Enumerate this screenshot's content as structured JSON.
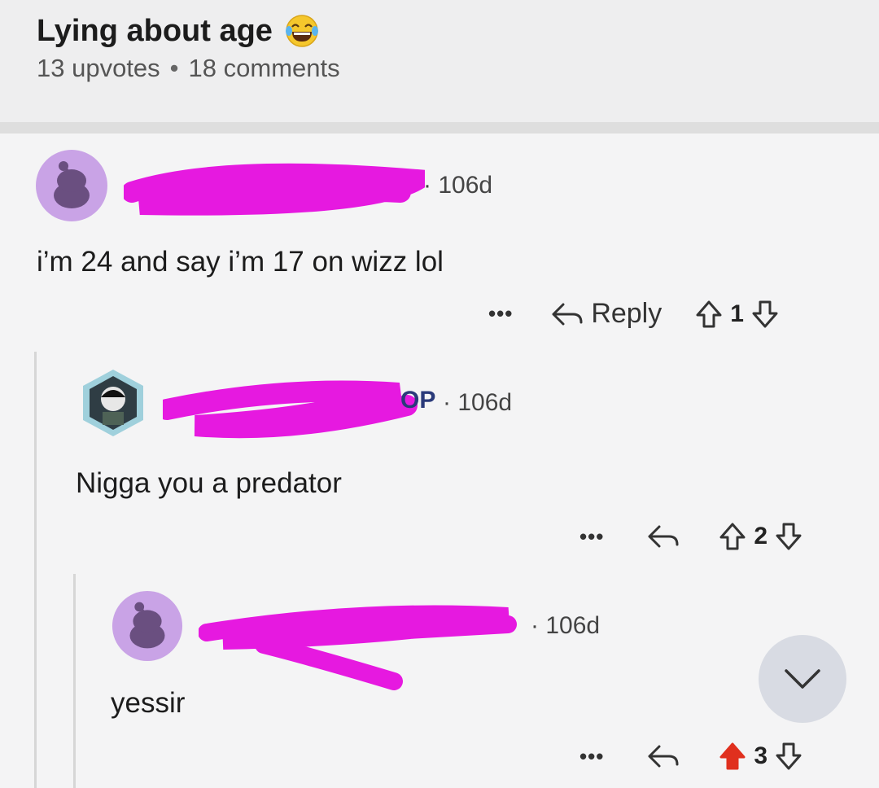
{
  "post": {
    "title": "Lying about age",
    "upvotes": "13 upvotes",
    "comments": "18 comments",
    "separator": "•"
  },
  "comments": [
    {
      "age": "· 106d",
      "text": "i’m 24 and say i’m 17 on wizz lol",
      "actions": {
        "more": "•••",
        "reply": "Reply",
        "score": "1"
      }
    },
    {
      "age": "· 106d",
      "op_visible": "OP",
      "text": "Nigga you a predator",
      "actions": {
        "more": "•••",
        "score": "2"
      }
    },
    {
      "age": "· 106d",
      "text": "yessir",
      "actions": {
        "more": "•••",
        "score": "3",
        "upvoted": true
      }
    }
  ],
  "colors": {
    "redaction": "#e619e0",
    "avatar_bg": "#c9a3e6",
    "upvote_active": "#e0301e"
  },
  "icons": {
    "emoji": "laughing-face-icon",
    "reply": "reply-arrow-icon",
    "upvote": "upvote-arrow-icon",
    "downvote": "downvote-arrow-icon",
    "scroll": "chevron-down-icon"
  }
}
